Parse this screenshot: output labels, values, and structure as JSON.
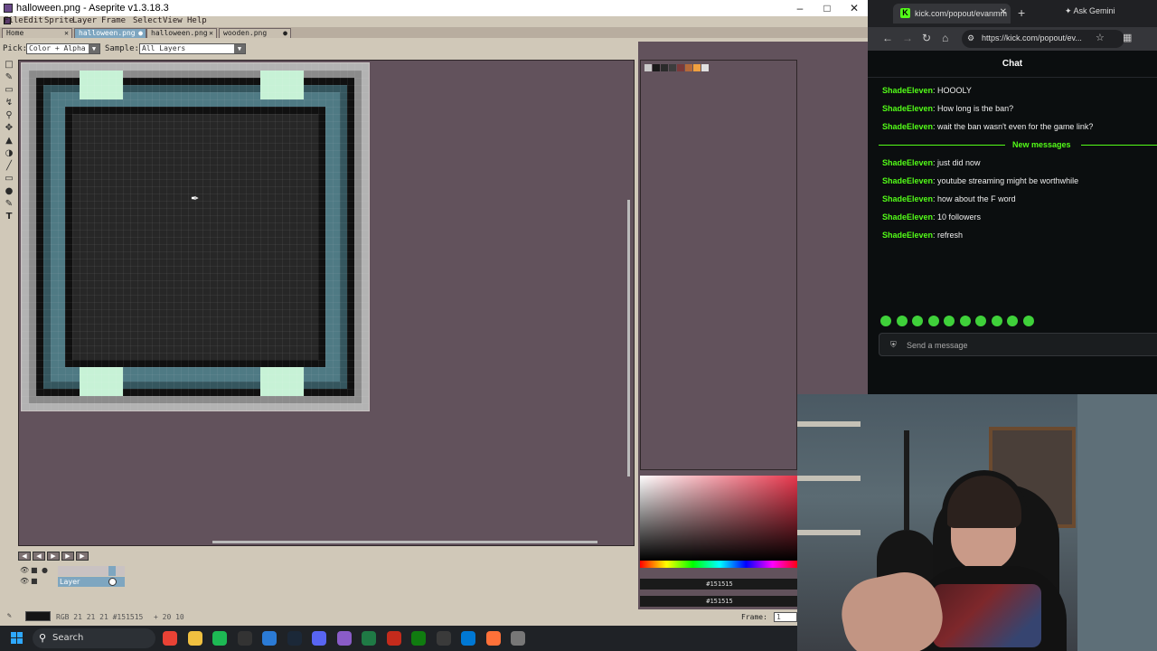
{
  "aseprite": {
    "title": "halloween.png - Aseprite v1.3.18.3",
    "menu": [
      "File",
      "Edit",
      "Sprite",
      "Layer",
      "Frame",
      "Select",
      "View",
      "Help"
    ],
    "tabs": [
      {
        "label": "Home",
        "active": false,
        "modified": false
      },
      {
        "label": "halloween.png",
        "active": true,
        "modified": true
      },
      {
        "label": "halloween.png",
        "active": false,
        "modified": false
      },
      {
        "label": "wooden.png",
        "active": false,
        "modified": true
      }
    ],
    "options": {
      "pick_label": "Pick:",
      "pick_value": "Color + Alpha",
      "sample_label": "Sample:",
      "sample_value": "All Layers"
    },
    "palette_colors": [
      "#c9c9c9",
      "#1a1a1a",
      "#2b2b2b",
      "#3d3d3d",
      "#7a3a3a",
      "#b56a3a",
      "#f0a040",
      "#e0e0e0"
    ],
    "color_hex_fg": "#151515",
    "color_hex_bg": "#151515",
    "layers": [
      {
        "name": "",
        "selected": false
      },
      {
        "name": "Layer",
        "selected": true
      }
    ],
    "status": {
      "color_readout": "RGB 21 21 21 #151515",
      "position_readout": "+ 20 10",
      "frame_label": "Frame:",
      "frame_value": "1"
    },
    "canvas": {
      "pixel_colors": {
        "frame_dark": "#101010",
        "edge_light": "#b3b3b3",
        "edge_mid": "#8b8b8b",
        "teal": "#4f7a84",
        "teal_dark": "#35565e",
        "mint": "#c7f2d6",
        "interior": "#272727"
      }
    }
  },
  "browser": {
    "tab_title": "kick.com/popout/evanmm",
    "gemini_label": "Ask Gemini",
    "url": "https://kick.com/popout/ev...",
    "chat_header": "Chat",
    "messages_before": [
      {
        "user": "ShadeEleven",
        "text": ": HOOOLY"
      },
      {
        "user": "ShadeEleven",
        "text": ": How long is the ban?"
      },
      {
        "user": "ShadeEleven",
        "text": ": wait the ban wasn't even for the game link?"
      }
    ],
    "new_messages_label": "New messages",
    "messages_after": [
      {
        "user": "ShadeEleven",
        "text": ": just did now"
      },
      {
        "user": "ShadeEleven",
        "text": ": youtube streaming might be worthwhile"
      },
      {
        "user": "ShadeEleven",
        "text": ": how about the F word"
      },
      {
        "user": "ShadeEleven",
        "text": ": 10 followers"
      },
      {
        "user": "ShadeEleven",
        "text": ": refresh"
      }
    ],
    "send_placeholder": "Send a message",
    "accent": "#53fc18"
  },
  "taskbar": {
    "search_label": "Search",
    "icons": [
      "chrome-icon",
      "file-explorer-icon",
      "spotify-icon",
      "terminal-icon",
      "vscode-icon",
      "steam-icon",
      "discord-icon",
      "aseprite-icon",
      "excel-icon",
      "filezilla-icon",
      "xbox-icon",
      "obs-icon",
      "mail-icon",
      "firefox-icon",
      "settings-icon"
    ]
  }
}
